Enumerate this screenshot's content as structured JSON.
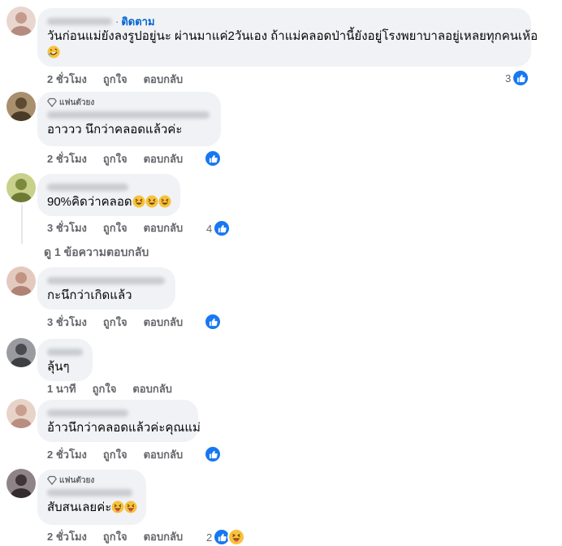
{
  "labels": {
    "follow": "ติดตาม",
    "fan": "แฟนตัวยง",
    "like": "ถูกใจ",
    "reply": "ตอบกลับ"
  },
  "comments": [
    {
      "text": "วันก่อนแม่ยังลงรูปอยู่นะ ผ่านมาแค่2วันเอง ถ้าแม่คลอดป่านี้ยังอยู่โรงพยาบาลอยู่เหลยทุกคนเห้อ",
      "time": "2 ชั่วโมง",
      "reaction_count": "3",
      "avatar_color": "#d8b8ad"
    },
    {
      "text": "อาววว นึกว่าคลอดแล้วค่ะ",
      "time": "2 ชั่วโมง",
      "reaction_count": "",
      "avatar_color": "#7a6a4c"
    },
    {
      "text": "90%คิดว่าคลอด",
      "time": "3 ชั่วโมง",
      "reaction_count": "4",
      "avatar_color": "#9aa866"
    },
    {
      "text": "กะนึกว่าเกิดแล้ว",
      "time": "3 ชั่วโมง",
      "reaction_count": "",
      "avatar_color": "#c9a79c"
    },
    {
      "text": "ลุ้นๆ",
      "time": "1 นาที",
      "reaction_count": "",
      "avatar_color": "#6b6c70"
    },
    {
      "text": "อ้าวนึกว่าคลอดแล้วค่ะคุณแม่",
      "time": "2 ชั่วโมง",
      "reaction_count": "",
      "avatar_color": "#cbb0a4"
    },
    {
      "text": "สับสนเลยค่ะ",
      "time": "2 ชั่วโมง",
      "reaction_count": "2",
      "avatar_color": "#5e5458"
    }
  ],
  "view_replies": "ดู 1 ข้อความตอบกลับ"
}
